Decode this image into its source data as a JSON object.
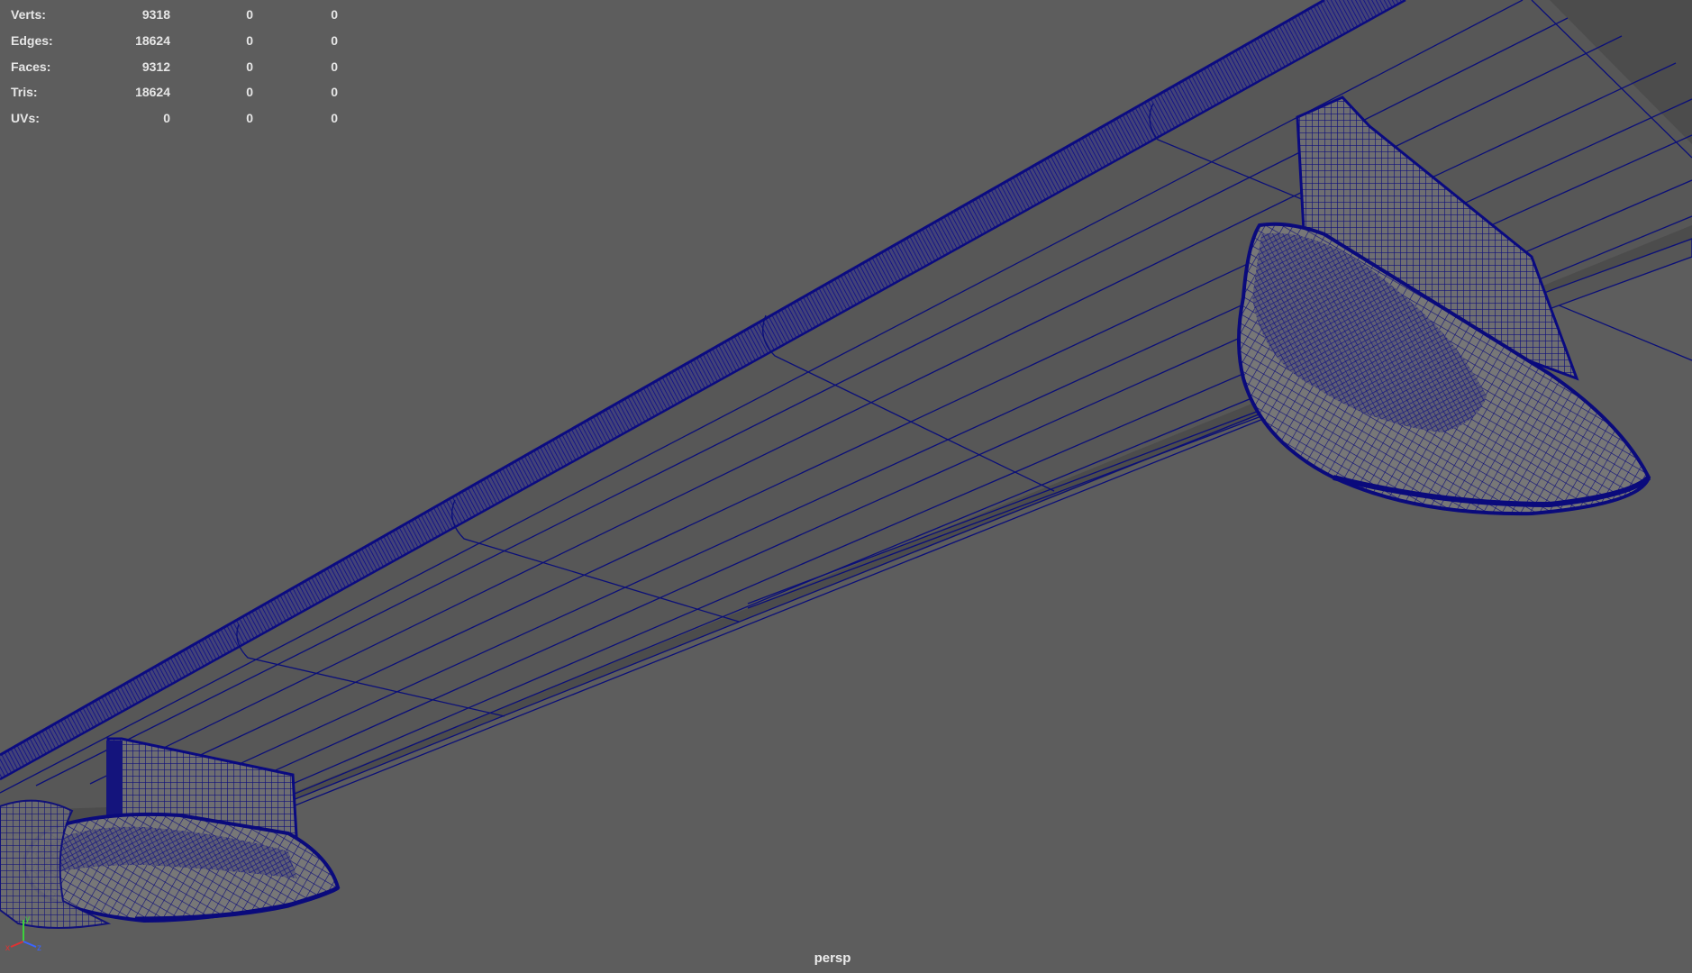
{
  "heads_up": {
    "rows": [
      {
        "label": "Verts:",
        "values": [
          "9318",
          "0",
          "0"
        ]
      },
      {
        "label": "Edges:",
        "values": [
          "18624",
          "0",
          "0"
        ]
      },
      {
        "label": "Faces:",
        "values": [
          "9312",
          "0",
          "0"
        ]
      },
      {
        "label": "Tris:",
        "values": [
          "18624",
          "0",
          "0"
        ]
      },
      {
        "label": "UVs:",
        "values": [
          "0",
          "0",
          "0"
        ]
      }
    ]
  },
  "viewport": {
    "camera": "persp",
    "background_color": "#5d5d5d",
    "wire_color": "#0b0f78",
    "wire_density_color": "#0a0a6e"
  },
  "axis_gizmo": {
    "labels": [
      "x",
      "y",
      "z"
    ],
    "icon": "axis-gizmo-icon"
  }
}
